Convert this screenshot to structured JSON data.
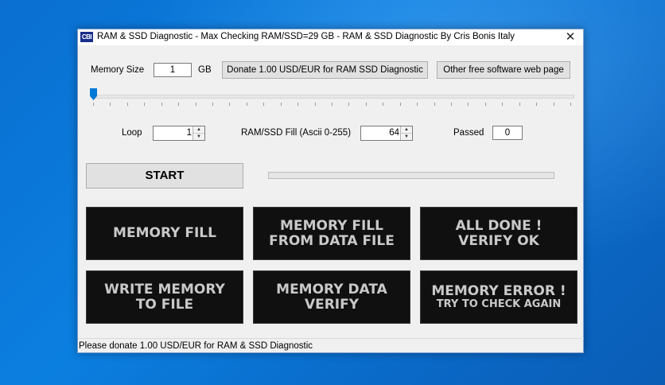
{
  "window": {
    "title": "RAM & SSD Diagnostic - Max Checking RAM/SSD=29 GB - RAM & SSD Diagnostic By Cris Bonis Italy",
    "icon_label": "CBI",
    "close_glyph": "✕"
  },
  "memory_size": {
    "label": "Memory Size",
    "value": "1",
    "unit": "GB"
  },
  "buttons": {
    "donate": "Donate 1.00 USD/EUR for RAM  SSD Diagnostic",
    "other_software": "Other free software web page",
    "start": "START"
  },
  "slider": {
    "value_fraction": 0.0
  },
  "loop": {
    "label": "Loop",
    "value": "1"
  },
  "fill": {
    "label": "RAM/SSD Fill (Ascii 0-255)",
    "value": "64"
  },
  "passed": {
    "label": "Passed",
    "value": "0"
  },
  "progress": {
    "value_fraction": 0.0,
    "fill_color": "#06b025"
  },
  "tiles": [
    {
      "line1": "MEMORY FILL",
      "line2": ""
    },
    {
      "line1": "MEMORY FILL",
      "line2": "FROM DATA FILE"
    },
    {
      "line1": "ALL DONE !",
      "line2": "VERIFY OK"
    },
    {
      "line1": "WRITE MEMORY",
      "line2": "TO FILE"
    },
    {
      "line1": "MEMORY DATA",
      "line2": "VERIFY"
    },
    {
      "line1": "MEMORY ERROR !",
      "line2": "TRY TO CHECK AGAIN"
    }
  ],
  "statusbar": {
    "text": "Please donate 1.00 USD/EUR for RAM & SSD Diagnostic"
  },
  "colors": {
    "accent": "#0078d7",
    "tile_background": "#101010",
    "tile_text": "#c9c9c9",
    "desktop": "#0b7fe0"
  }
}
